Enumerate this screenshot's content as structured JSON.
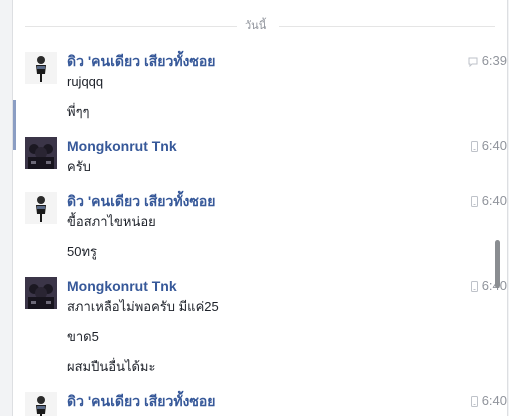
{
  "date_divider": "วันนี้",
  "messages": [
    {
      "sender": "ดิว 'คนเดียว เสียวทั้งซอย",
      "time": "6:39",
      "device_icon": "chat-icon",
      "lines": [
        "rujqqq",
        "พี่ๆๆ"
      ]
    },
    {
      "sender": "Mongkonrut Tnk",
      "time": "6:40",
      "device_icon": "mobile-icon",
      "lines": [
        "ครับ"
      ]
    },
    {
      "sender": "ดิว 'คนเดียว เสียวทั้งซอย",
      "time": "6:40",
      "device_icon": "mobile-icon",
      "lines": [
        "ขื้อสภาไขหน่อย",
        "50ทรู"
      ]
    },
    {
      "sender": "Mongkonrut Tnk",
      "time": "6:40",
      "device_icon": "mobile-icon",
      "lines": [
        "สภาเหลือไม่พอครับ มีแค่25",
        "ขาด5",
        "ผสมปืนอื่นได้มะ"
      ]
    },
    {
      "sender": "ดิว 'คนเดียว เสียวทั้งซอย",
      "time": "6:40",
      "device_icon": "mobile-icon",
      "lines": []
    }
  ],
  "colors": {
    "sender": "#365899",
    "text": "#1d2129",
    "meta": "#90949c"
  }
}
